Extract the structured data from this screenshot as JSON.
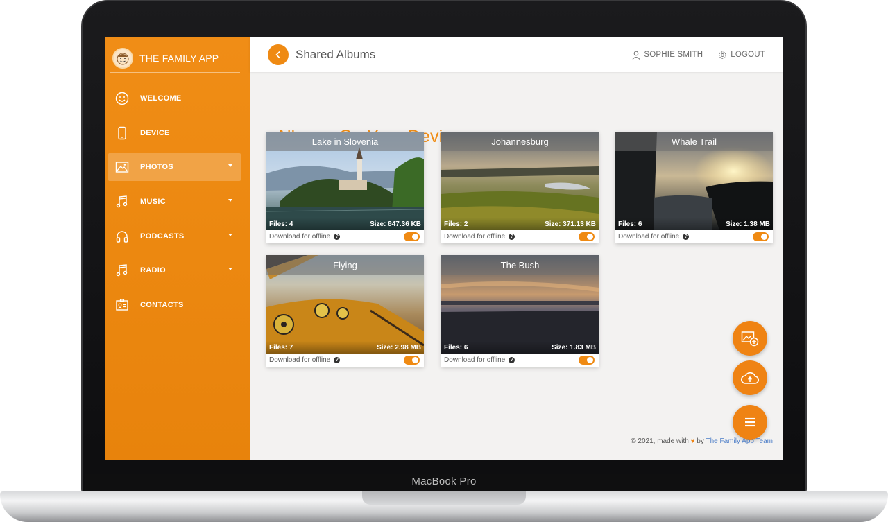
{
  "device": {
    "brand_label": "MacBook Pro"
  },
  "app": {
    "name": "THE FAMILY APP"
  },
  "sidebar": {
    "items": [
      {
        "label": "WELCOME",
        "icon": "smiley-icon",
        "active": false,
        "has_submenu": false
      },
      {
        "label": "DEVICE",
        "icon": "phone-icon",
        "active": false,
        "has_submenu": false
      },
      {
        "label": "PHOTOS",
        "icon": "image-icon",
        "active": true,
        "has_submenu": true
      },
      {
        "label": "MUSIC",
        "icon": "music-note-icon",
        "active": false,
        "has_submenu": true
      },
      {
        "label": "PODCASTS",
        "icon": "headphones-icon",
        "active": false,
        "has_submenu": true
      },
      {
        "label": "RADIO",
        "icon": "music-note-icon",
        "active": false,
        "has_submenu": true
      },
      {
        "label": "CONTACTS",
        "icon": "contact-card-icon",
        "active": false,
        "has_submenu": false
      }
    ]
  },
  "topbar": {
    "title": "Shared Albums",
    "user_name": "SOPHIE SMITH",
    "logout_label": "LOGOUT"
  },
  "main": {
    "heading": "Albums On Your Device",
    "albums": [
      {
        "title": "Lake in Slovenia",
        "files": "Files: 4",
        "size": "Size: 847.36 KB",
        "download_label": "Download for offline",
        "offline_enabled": true
      },
      {
        "title": "Johannesburg",
        "files": "Files: 2",
        "size": "Size: 371.13 KB",
        "download_label": "Download for offline",
        "offline_enabled": true
      },
      {
        "title": "Whale Trail",
        "files": "Files: 6",
        "size": "Size: 1.38 MB",
        "download_label": "Download for offline",
        "offline_enabled": true
      },
      {
        "title": "Flying",
        "files": "Files: 7",
        "size": "Size: 2.98 MB",
        "download_label": "Download for offline",
        "offline_enabled": true
      },
      {
        "title": "The Bush",
        "files": "Files: 6",
        "size": "Size: 1.83 MB",
        "download_label": "Download for offline",
        "offline_enabled": true
      }
    ]
  },
  "fabs": [
    {
      "icon": "add-photo-icon"
    },
    {
      "icon": "cloud-upload-icon"
    },
    {
      "icon": "menu-icon"
    }
  ],
  "footer": {
    "prefix": "© 2021, made with",
    "by": "by",
    "team_link": "The Family App Team"
  },
  "colors": {
    "accent": "#ef8a13",
    "sidebar": "#ec8810",
    "content_bg": "#f3f2f1",
    "link": "#4a7cc7"
  }
}
